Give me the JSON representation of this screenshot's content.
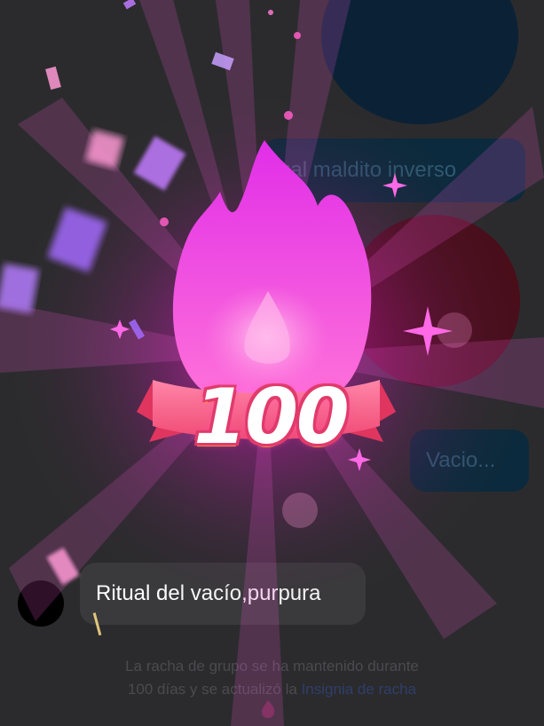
{
  "chat": {
    "bubbles": [
      {
        "text": "ual maldito inverso"
      },
      {
        "text": "Vacio..."
      }
    ],
    "incoming": {
      "text": "Ritual del vacío,purpura"
    }
  },
  "notice": {
    "line1": "La racha de grupo se ha mantenido durante",
    "line2_prefix": "100 días y se actualizó la ",
    "link": "Insignia de racha"
  },
  "badge": {
    "number": "100",
    "icon": "flame-icon",
    "colors": {
      "flame": "#ff4fe0",
      "ribbon": "#ff5a8a"
    }
  }
}
